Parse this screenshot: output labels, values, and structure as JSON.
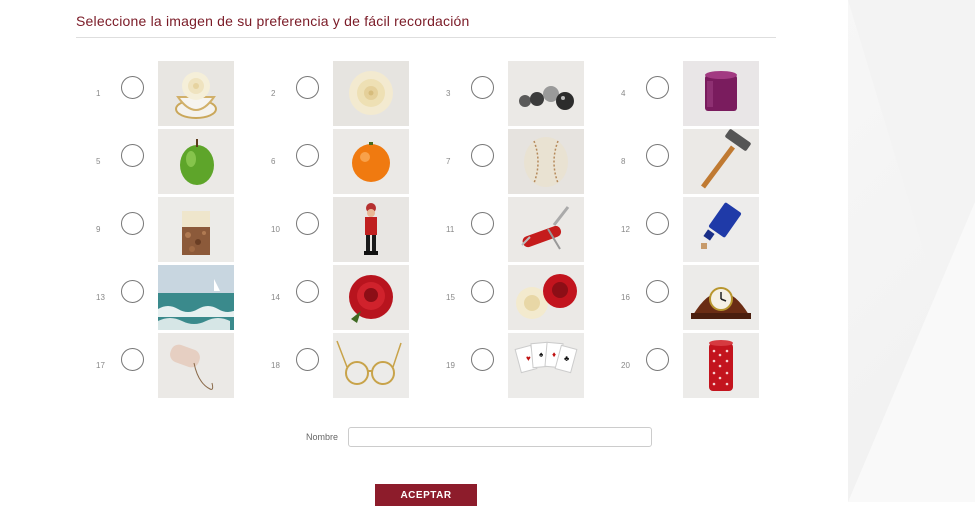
{
  "page": {
    "title": "Seleccione la imagen de su preferencia y de fácil recordación"
  },
  "options": [
    {
      "number": "1",
      "image": "white-rose-in-teacup"
    },
    {
      "number": "2",
      "image": "white-rose"
    },
    {
      "number": "3",
      "image": "steel-balls"
    },
    {
      "number": "4",
      "image": "purple-candle-holder"
    },
    {
      "number": "5",
      "image": "green-apple"
    },
    {
      "number": "6",
      "image": "orange"
    },
    {
      "number": "7",
      "image": "baseball"
    },
    {
      "number": "8",
      "image": "hammer"
    },
    {
      "number": "9",
      "image": "candle"
    },
    {
      "number": "10",
      "image": "toy-soldier"
    },
    {
      "number": "11",
      "image": "swiss-army-knife"
    },
    {
      "number": "12",
      "image": "blue-bottle"
    },
    {
      "number": "13",
      "image": "ocean-sailboat"
    },
    {
      "number": "14",
      "image": "red-rose"
    },
    {
      "number": "15",
      "image": "white-and-red-roses"
    },
    {
      "number": "16",
      "image": "mantel-clock"
    },
    {
      "number": "17",
      "image": "twine-spool"
    },
    {
      "number": "18",
      "image": "eyeglasses"
    },
    {
      "number": "19",
      "image": "playing-cards"
    },
    {
      "number": "20",
      "image": "red-polka-dot-tin"
    }
  ],
  "form": {
    "name_label": "Nombre",
    "name_value": "",
    "name_placeholder": "",
    "submit_label": "ACEPTAR"
  },
  "colors": {
    "accent": "#8d1c2b",
    "title": "#7a1a26"
  }
}
